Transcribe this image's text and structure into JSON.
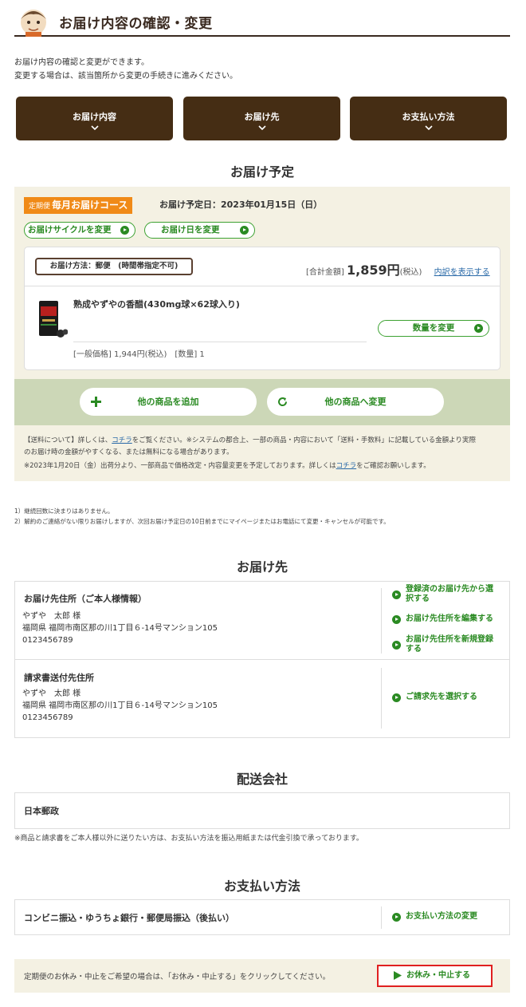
{
  "header": {
    "title": "お届け内容の確認・変更"
  },
  "intro": {
    "line1": "お届け内容の確認と変更ができます。",
    "line2": "変更する場合は、該当箇所から変更の手続きに進みください。"
  },
  "nav": {
    "contents": "お届け内容",
    "destination": "お届け先",
    "payment": "お支払い方法"
  },
  "schedule": {
    "section_title": "お届け予定",
    "course_prefix": "定期便",
    "course_name": "毎月お届けコース",
    "delivery_date": "お届け予定日：2023年01月15日（日）",
    "change_cycle": "お届けサイクルを変更",
    "change_date": "お届け日を変更",
    "method": "お届け方法：郵便　(時間帯指定不可)",
    "total_label": "[合計金額]",
    "total_amount": "1,859円",
    "tax_label": "(税込)",
    "breakdown_link": "内訳を表示する",
    "product_name": "熟成やずやの香醋(430mg球×62球入り)",
    "product_price": "[一般価格] 1,944円(税込)　[数量] 1",
    "change_qty": "数量を変更",
    "add_product": "他の商品を追加",
    "swap_product": "他の商品へ変更",
    "note1_a": "【送料について】詳しくは、",
    "note1_link": "コチラ",
    "note1_b": "をご覧ください。※システムの都合上、一部の商品・内容において「送料・手数料」に記載している金額より実際",
    "note1_c": "のお届け時の金額がやすくなる、または無料になる場合があります。",
    "note2_a": "※2023年1月20日（金）出荷分より、一部商品で価格改定・内容量変更を予定しております。詳しくは",
    "note2_link": "コチラ",
    "note2_b": "をご確認お願いします。"
  },
  "footnotes": {
    "f1": "1）継続回数に決まりはありません。",
    "f2": "2）解約のご連絡がない限りお届けしますが、次回お届け予定日の10日前までにマイページまたはお電話にて変更・キャンセルが可能です。"
  },
  "destination": {
    "section_title": "お届け先",
    "address_title": "お届け先住所（ご本人様情報）",
    "name": "やずや　太郎 様",
    "address": "福岡県 福岡市南区那の川1丁目６-14号マンション105",
    "phone": "0123456789",
    "select_registered_1": "登録済のお届け先から選",
    "select_registered_2": "択する",
    "edit_address": "お届け先住所を編集する",
    "new_address_1": "お届け先住所を新規登録",
    "new_address_2": "する",
    "invoice_title": "請求書送付先住所",
    "invoice_name": "やずや　太郎 様",
    "invoice_address": "福岡県 福岡市南区那の川1丁目６-14号マンション105",
    "invoice_phone": "0123456789",
    "select_invoice": "ご請求先を選択する"
  },
  "carrier": {
    "section_title": "配送会社",
    "name": "日本郵政",
    "note": "※商品と請求書をご本人様以外に送りたい方は、お支払い方法を振込用紙または代金引換で承っております。"
  },
  "payment": {
    "section_title": "お支払い方法",
    "method": "コンビニ振込・ゆうちょ銀行・郵便局振込（後払い）",
    "change_link": "お支払い方法の変更"
  },
  "pause": {
    "text": "定期便のお休み・中止をご希望の場合は、「お休み・中止する」をクリックしてください。",
    "button": "お休み・中止する"
  },
  "colors": {
    "brown": "#452d14",
    "green": "#2a8a22",
    "orange": "#f08a17",
    "beige": "#f4f1e3",
    "olive": "#ccd7b7",
    "red_highlight": "#e02020"
  }
}
